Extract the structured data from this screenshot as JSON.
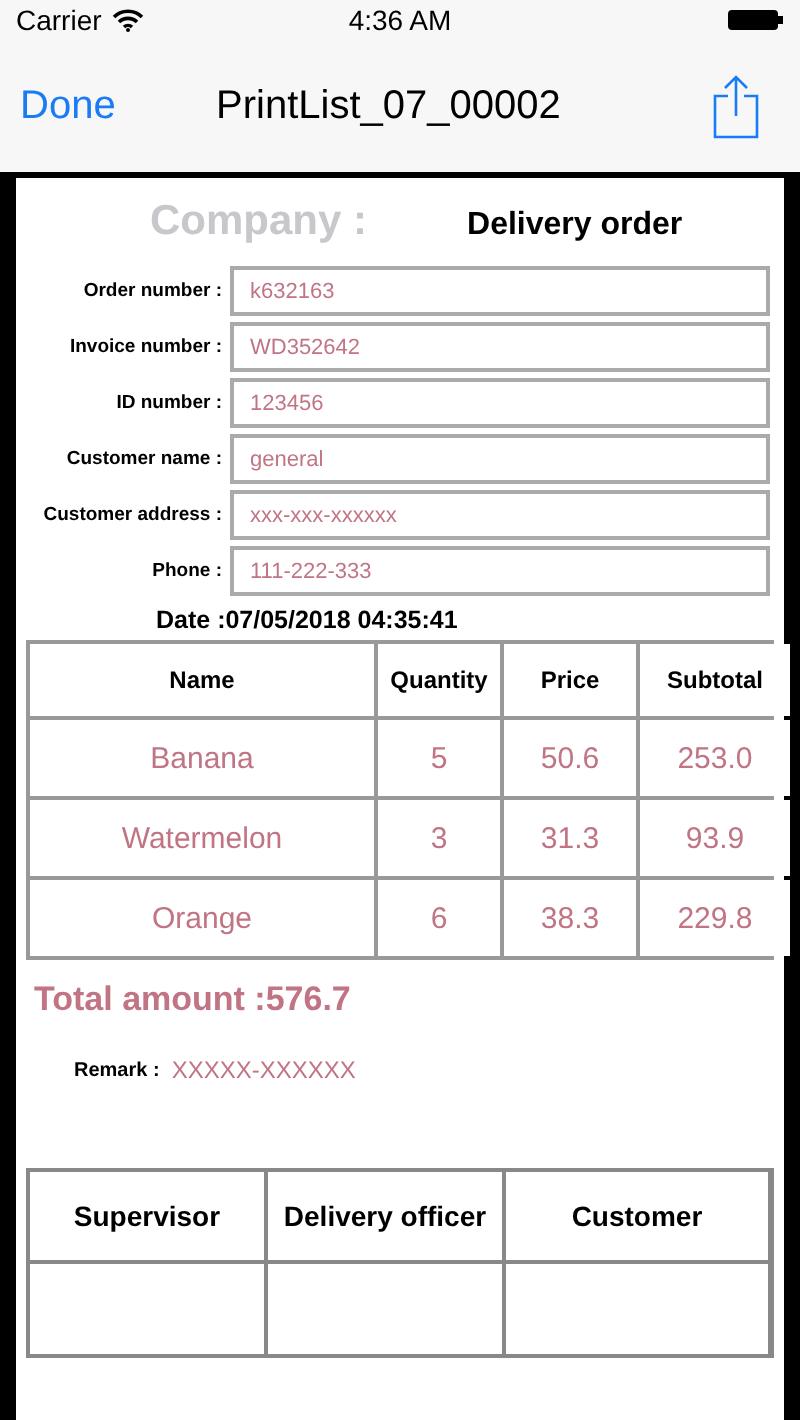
{
  "status_bar": {
    "carrier": "Carrier",
    "time": "4:36 AM"
  },
  "nav": {
    "done": "Done",
    "title": "PrintList_07_00002"
  },
  "document": {
    "company": "Company :",
    "doc_title": "Delivery order",
    "fields": [
      {
        "label": "Order number :",
        "value": "k632163"
      },
      {
        "label": "Invoice number :",
        "value": "WD352642"
      },
      {
        "label": "ID number :",
        "value": "123456"
      },
      {
        "label": "Customer name :",
        "value": "general"
      },
      {
        "label": "Customer address :",
        "value": "xxx-xxx-xxxxxx"
      },
      {
        "label": "Phone :",
        "value": "111-222-333"
      }
    ],
    "date": "Date :07/05/2018 04:35:41",
    "table": {
      "columns": [
        "Name",
        "Quantity",
        "Price",
        "Subtotal"
      ],
      "rows": [
        [
          "Banana",
          "5",
          "50.6",
          "253.0"
        ],
        [
          "Watermelon",
          "3",
          "31.3",
          "93.9"
        ],
        [
          "Orange",
          "6",
          "38.3",
          "229.8"
        ]
      ]
    },
    "total": "Total amount :576.7",
    "remark": {
      "label": "Remark :",
      "value": "XXXXX-XXXXXX"
    },
    "signatures": [
      "Supervisor",
      "Delivery officer",
      "Customer"
    ]
  }
}
